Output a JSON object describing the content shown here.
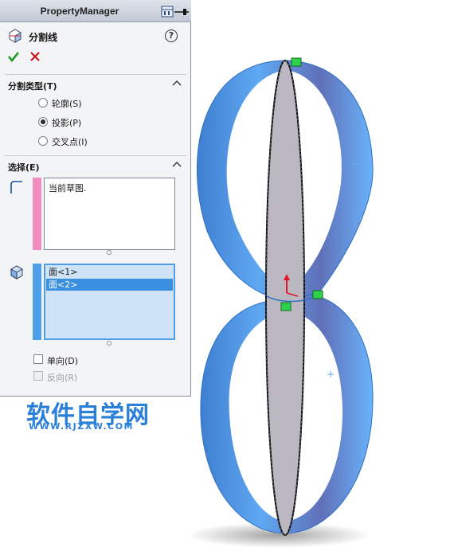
{
  "header": {
    "title": "PropertyManager"
  },
  "feature": {
    "title": "分割线"
  },
  "actions": {
    "help": "?"
  },
  "split_type": {
    "label": "分割类型(T)",
    "options": [
      {
        "label": "轮廓(S)"
      },
      {
        "label": "投影(P)"
      },
      {
        "label": "交叉点(I)"
      }
    ],
    "selected_index": 1
  },
  "selections": {
    "label": "选择(E)",
    "sketch_value": "当前草图.",
    "faces": [
      "面<1>",
      "面<2>"
    ],
    "selected_face_index": 1,
    "single_direction": "单向(D)",
    "reverse": "反向(R)"
  },
  "watermark": {
    "main": "软件自学网",
    "url": "WWW.RJZXW.COM"
  },
  "colors": {
    "ring": "#4aa3f5",
    "pink_strip": "#f28dc4",
    "blue_strip": "#4f9fe8",
    "watermark": "#2a7fd9"
  }
}
